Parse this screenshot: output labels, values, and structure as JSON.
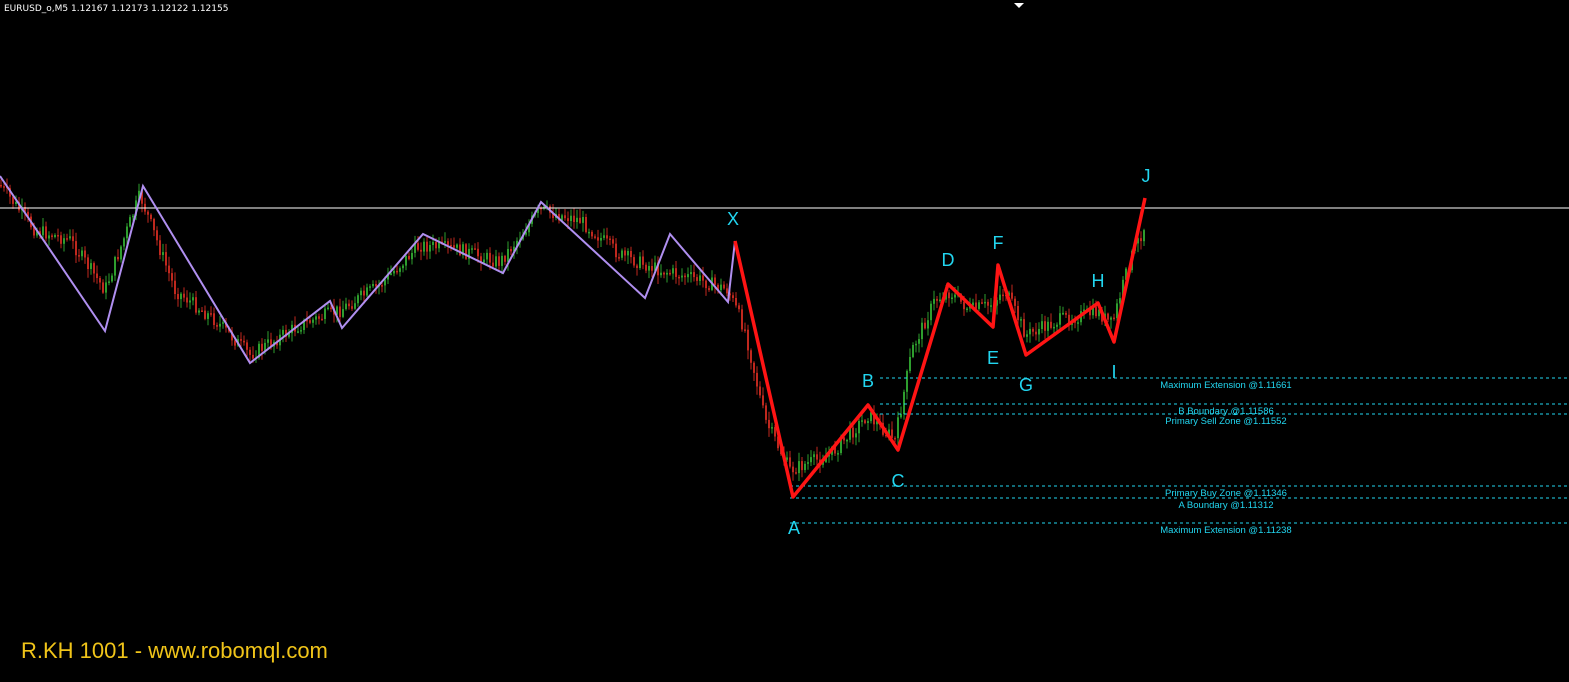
{
  "header": {
    "symbol": "EURUSD_o,M5",
    "ohlc": "1.12167 1.12173 1.12122 1.12155"
  },
  "watermark": "R.KH 1001 - www.robomql.com",
  "colors": {
    "background": "#000000",
    "bull_candle": "#2e9e2e",
    "bear_candle": "#c0281e",
    "zigzag": "#b08ff0",
    "pattern": "#ff1414",
    "wave_labels": "#22d6f0",
    "zone_lines": "#22d6f0",
    "watermark": "#f0c419",
    "price_line": "#ffffff"
  },
  "chart_data": {
    "type": "line",
    "symbol": "EURUSD_o",
    "timeframe": "M5",
    "current_price": 1.12155,
    "pattern_points": [
      {
        "label": "X",
        "price": 1.1201
      },
      {
        "label": "A",
        "price": 1.1128
      },
      {
        "label": "B",
        "price": 1.1158
      },
      {
        "label": "C",
        "price": 1.1145
      },
      {
        "label": "D",
        "price": 1.1186
      },
      {
        "label": "E",
        "price": 1.1174
      },
      {
        "label": "F",
        "price": 1.1192
      },
      {
        "label": "G",
        "price": 1.1171
      },
      {
        "label": "H",
        "price": 1.118
      },
      {
        "label": "I",
        "price": 1.1168
      },
      {
        "label": "J",
        "price": 1.1212
      }
    ],
    "zones": [
      {
        "label": "Maximum Extension @1.11661",
        "price": 1.11661
      },
      {
        "label": "B Boundary @1.11586",
        "price": 1.11586
      },
      {
        "label": "Primary Sell Zone @1.11552",
        "price": 1.11552
      },
      {
        "label": "Primary Buy Zone @1.11346",
        "price": 1.11346
      },
      {
        "label": "A Boundary @1.11312",
        "price": 1.11312
      },
      {
        "label": "Maximum Extension @1.11238",
        "price": 1.11238
      }
    ]
  }
}
